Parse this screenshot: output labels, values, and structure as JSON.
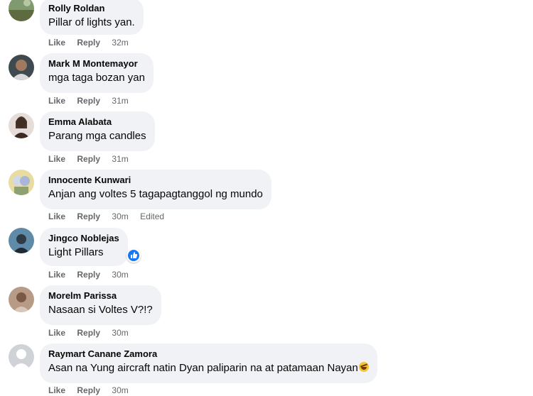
{
  "comments": [
    {
      "author": "Rolly Roldan",
      "text": "Pillar of lights yan.",
      "like": "Like",
      "reply": "Reply",
      "time": "32m",
      "avatar": "landscape-photo"
    },
    {
      "author": "Mark M Montemayor",
      "text": "mga taga bozan yan",
      "like": "Like",
      "reply": "Reply",
      "time": "31m",
      "avatar": "man-photo"
    },
    {
      "author": "Emma Alabata",
      "text": "Parang mga candles",
      "like": "Like",
      "reply": "Reply",
      "time": "31m",
      "avatar": "woman-photo"
    },
    {
      "author": "Innocente Kunwari",
      "text": "Anjan ang voltes 5 tagapagtanggol ng mundo",
      "like": "Like",
      "reply": "Reply",
      "time": "30m",
      "edited": "Edited",
      "avatar": "cartoon-photo"
    },
    {
      "author": "Jingco Noblejas",
      "text": "Light Pillars",
      "like": "Like",
      "reply": "Reply",
      "time": "30m",
      "reaction": "like-reaction-icon",
      "avatar": "man-cap-photo"
    },
    {
      "author": "Morelm Parissa",
      "text": "Nasaan si Voltes V?!?",
      "like": "Like",
      "reply": "Reply",
      "time": "30m",
      "avatar": "person-photo"
    },
    {
      "author": "Raymart Canane Zamora",
      "text": "Asan na Yung aircraft natin Dyan paliparin na at patamaan Nayan",
      "emoji": "rofl-emoji",
      "like": "Like",
      "reply": "Reply",
      "time": "30m",
      "avatar": "default-avatar"
    }
  ],
  "colors": {
    "bubble": "#f0f2f5",
    "name": "#050505",
    "meta": "#65676b",
    "reaction": "#1877f2"
  }
}
